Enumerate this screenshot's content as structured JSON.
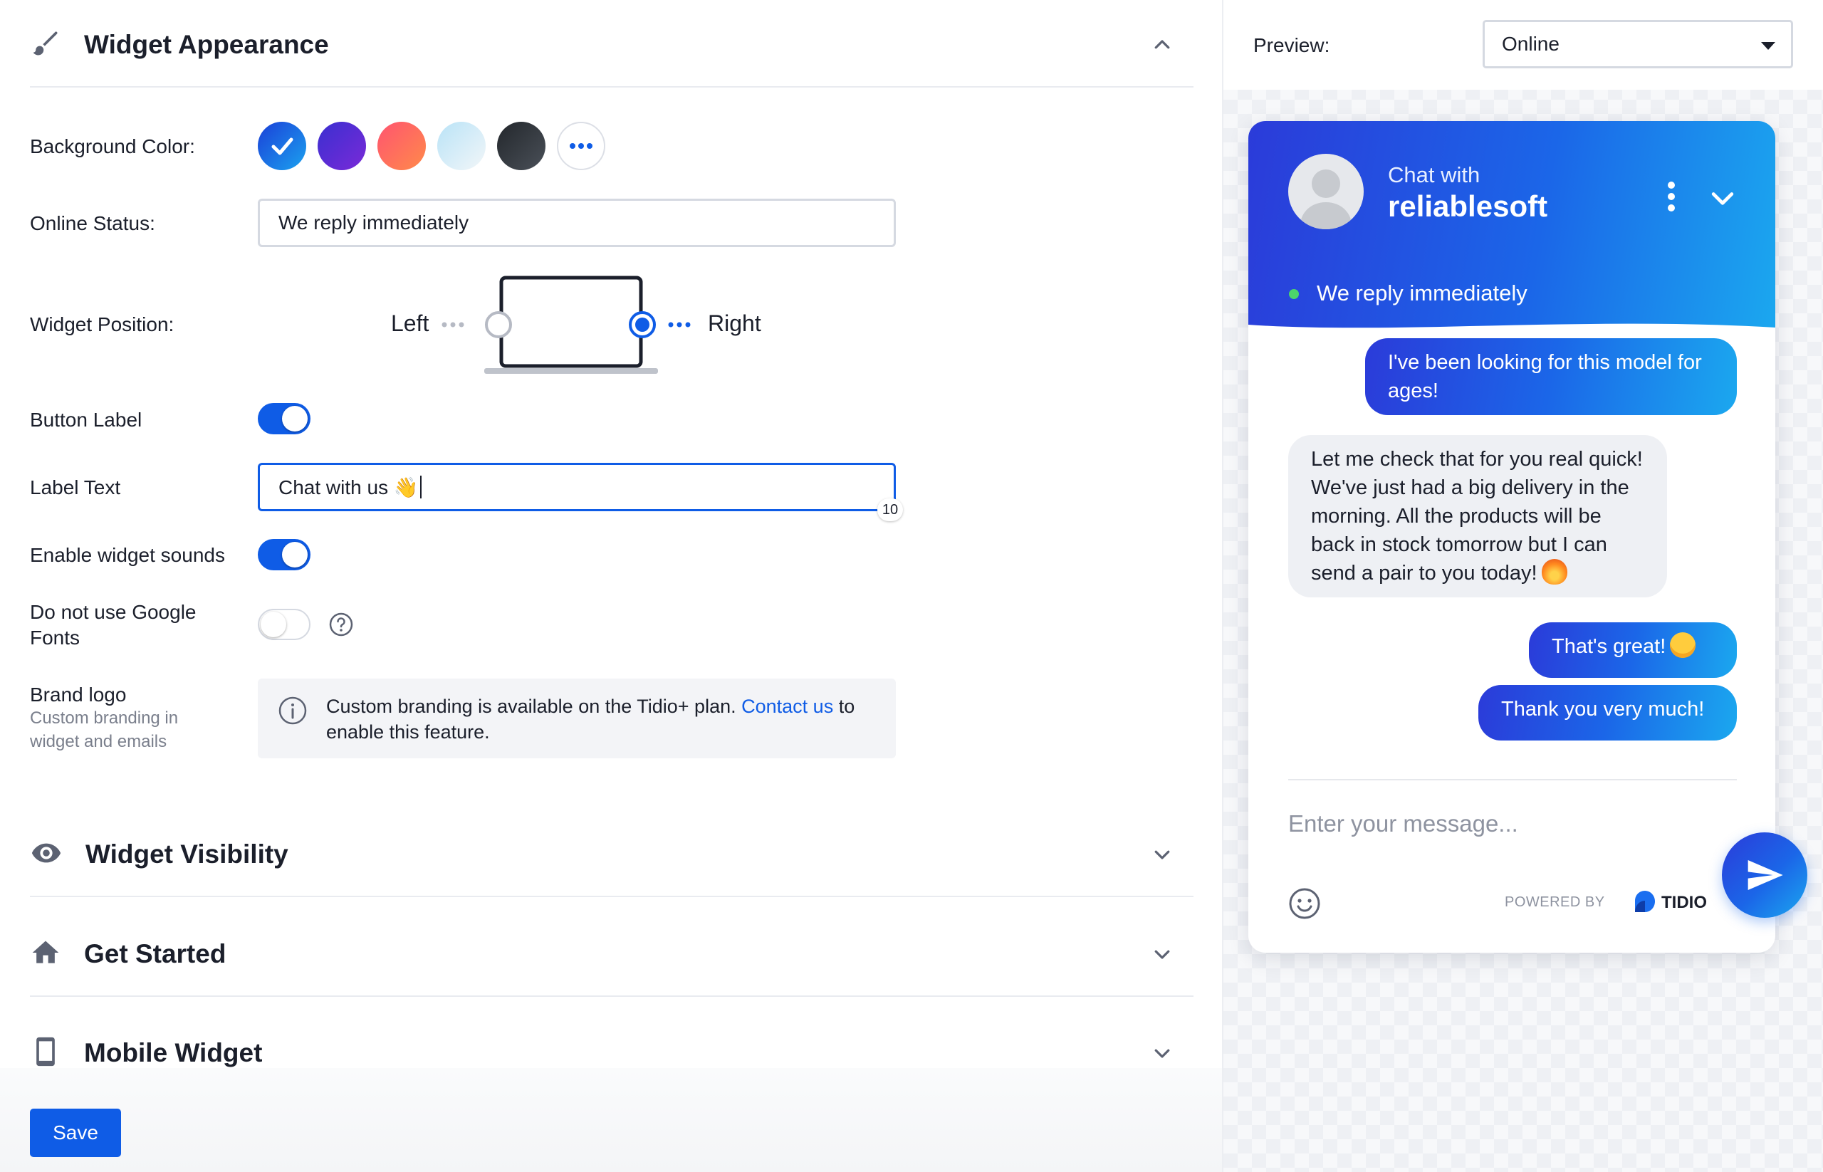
{
  "sections": {
    "appearance": "Widget Appearance",
    "visibility": "Widget Visibility",
    "get_started": "Get Started",
    "mobile": "Mobile Widget"
  },
  "appearance": {
    "background_color_label": "Background Color:",
    "colors": [
      "#1f5fe4",
      "#5a2ad6",
      "#ff6a5b",
      "#cfe9f5",
      "#2f3338"
    ],
    "selected_color_index": 0,
    "online_status_label": "Online Status:",
    "online_status_value": "We reply immediately",
    "widget_position_label": "Widget Position:",
    "position_left": "Left",
    "position_right": "Right",
    "position_selected": "Right",
    "button_label_label": "Button Label",
    "button_label_on": true,
    "label_text_label": "Label Text",
    "label_text_value": "Chat with us 👋",
    "label_text_counter": "10",
    "sounds_label": "Enable widget sounds",
    "sounds_on": true,
    "google_fonts_label": "Do not use Google Fonts",
    "google_fonts_on": false,
    "brand_logo_label": "Brand logo",
    "brand_logo_sub": "Custom branding in widget and emails",
    "branding_info": "Custom branding is available on the Tidio+ plan.",
    "branding_link": "Contact us",
    "branding_info_end": "to enable this feature."
  },
  "save_label": "Save",
  "preview": {
    "label": "Preview:",
    "mode": "Online",
    "chat": {
      "chat_with": "Chat with",
      "name": "reliablesoft",
      "status": "We reply immediately",
      "messages": [
        {
          "from": "visitor",
          "text": "I've been looking for this model for ages!"
        },
        {
          "from": "operator",
          "text": "Let me check that for you real quick! We've just had a big delivery in the morning. All the products will be back in stock tomorrow but I can send a pair to you today!",
          "emoji": "🔥"
        },
        {
          "from": "visitor",
          "text": "That's great!",
          "emoji": "😄"
        },
        {
          "from": "visitor",
          "text": "Thank you very much!"
        }
      ],
      "input_placeholder": "Enter your message...",
      "powered_by": "POWERED BY",
      "brand": "TIDIO"
    }
  },
  "accent_color": "#0f5ce6"
}
